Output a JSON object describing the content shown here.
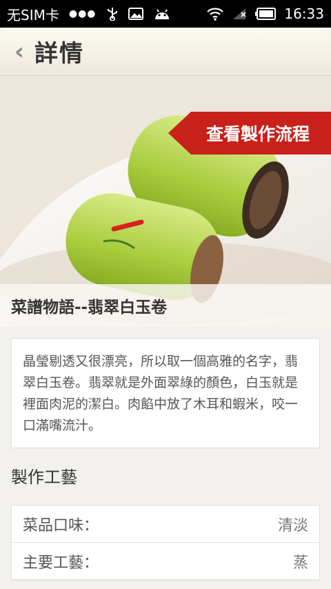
{
  "status_bar": {
    "carrier": "无SIM卡",
    "time": "16:33",
    "icons": [
      "usb-icon",
      "image-icon",
      "android-icon",
      "wifi-icon",
      "signal-icon",
      "battery-icon"
    ]
  },
  "header": {
    "back_glyph": "‹",
    "title": "詳情"
  },
  "hero": {
    "process_button": "查看製作流程",
    "dish_name": "菜譜物語--翡翠白玉卷"
  },
  "description": "晶瑩剔透又很漂亮，所以取一個高雅的名字，翡翠白玉卷。翡翠就是外面翠綠的顏色，白玉就是裡面肉泥的潔白。肉餡中放了木耳和蝦米，咬一口滿嘴流汁。",
  "craft_section": {
    "heading": "製作工藝",
    "rows": [
      {
        "label": "菜品口味：",
        "value": "清淡"
      },
      {
        "label": "主要工藝：",
        "value": "蒸"
      }
    ]
  },
  "colors": {
    "accent_red": "#c8201a",
    "status_bar": "#000000",
    "title_bar": "#f4efe3"
  }
}
